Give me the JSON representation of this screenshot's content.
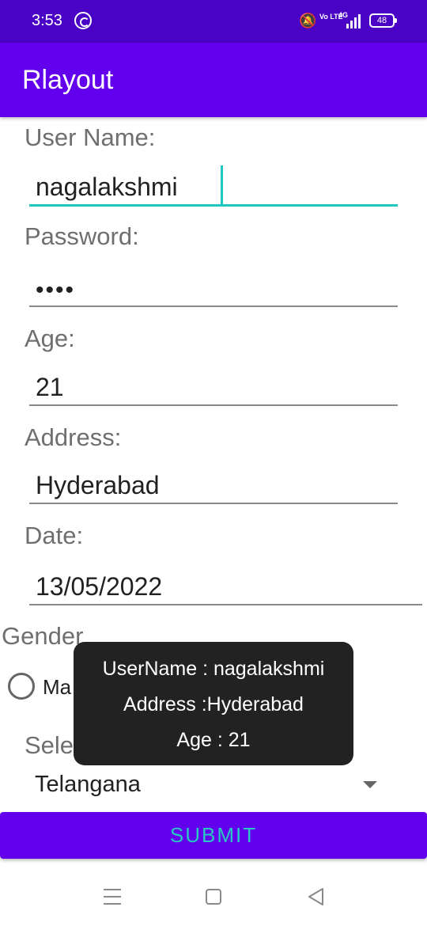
{
  "status_bar": {
    "time": "3:53",
    "volte": "Vo LTE",
    "network": "4G",
    "battery": "48",
    "icons": [
      "whatsapp-icon",
      "bell-off-icon",
      "volte-icon",
      "signal-icon",
      "battery-icon"
    ]
  },
  "app_bar": {
    "title": "Rlayout",
    "color": "#6200ee"
  },
  "form": {
    "username": {
      "label": "User Name:",
      "value": "nagalakshmi"
    },
    "password": {
      "label": "Password:",
      "value": "••••"
    },
    "age": {
      "label": "Age:",
      "value": "21"
    },
    "address": {
      "label": "Address:",
      "value": "Hyderabad"
    },
    "date": {
      "label": "Date:",
      "value": "13/05/2022"
    },
    "gender": {
      "label": "Gender",
      "option_visible": "Ma"
    },
    "state": {
      "label_visible": "Sele",
      "selected": "Telangana"
    },
    "submit_label": "SUBMIT"
  },
  "toast": {
    "lines": [
      "UserName : nagalakshmi",
      "Address :Hyderabad",
      "Age : 21"
    ]
  },
  "nav_bar": {
    "icons": [
      "menu-icon",
      "home-icon",
      "back-icon"
    ]
  },
  "colors": {
    "accent": "#1fc7c0",
    "primary": "#6200ee",
    "status_bar": "#4a03c4"
  }
}
